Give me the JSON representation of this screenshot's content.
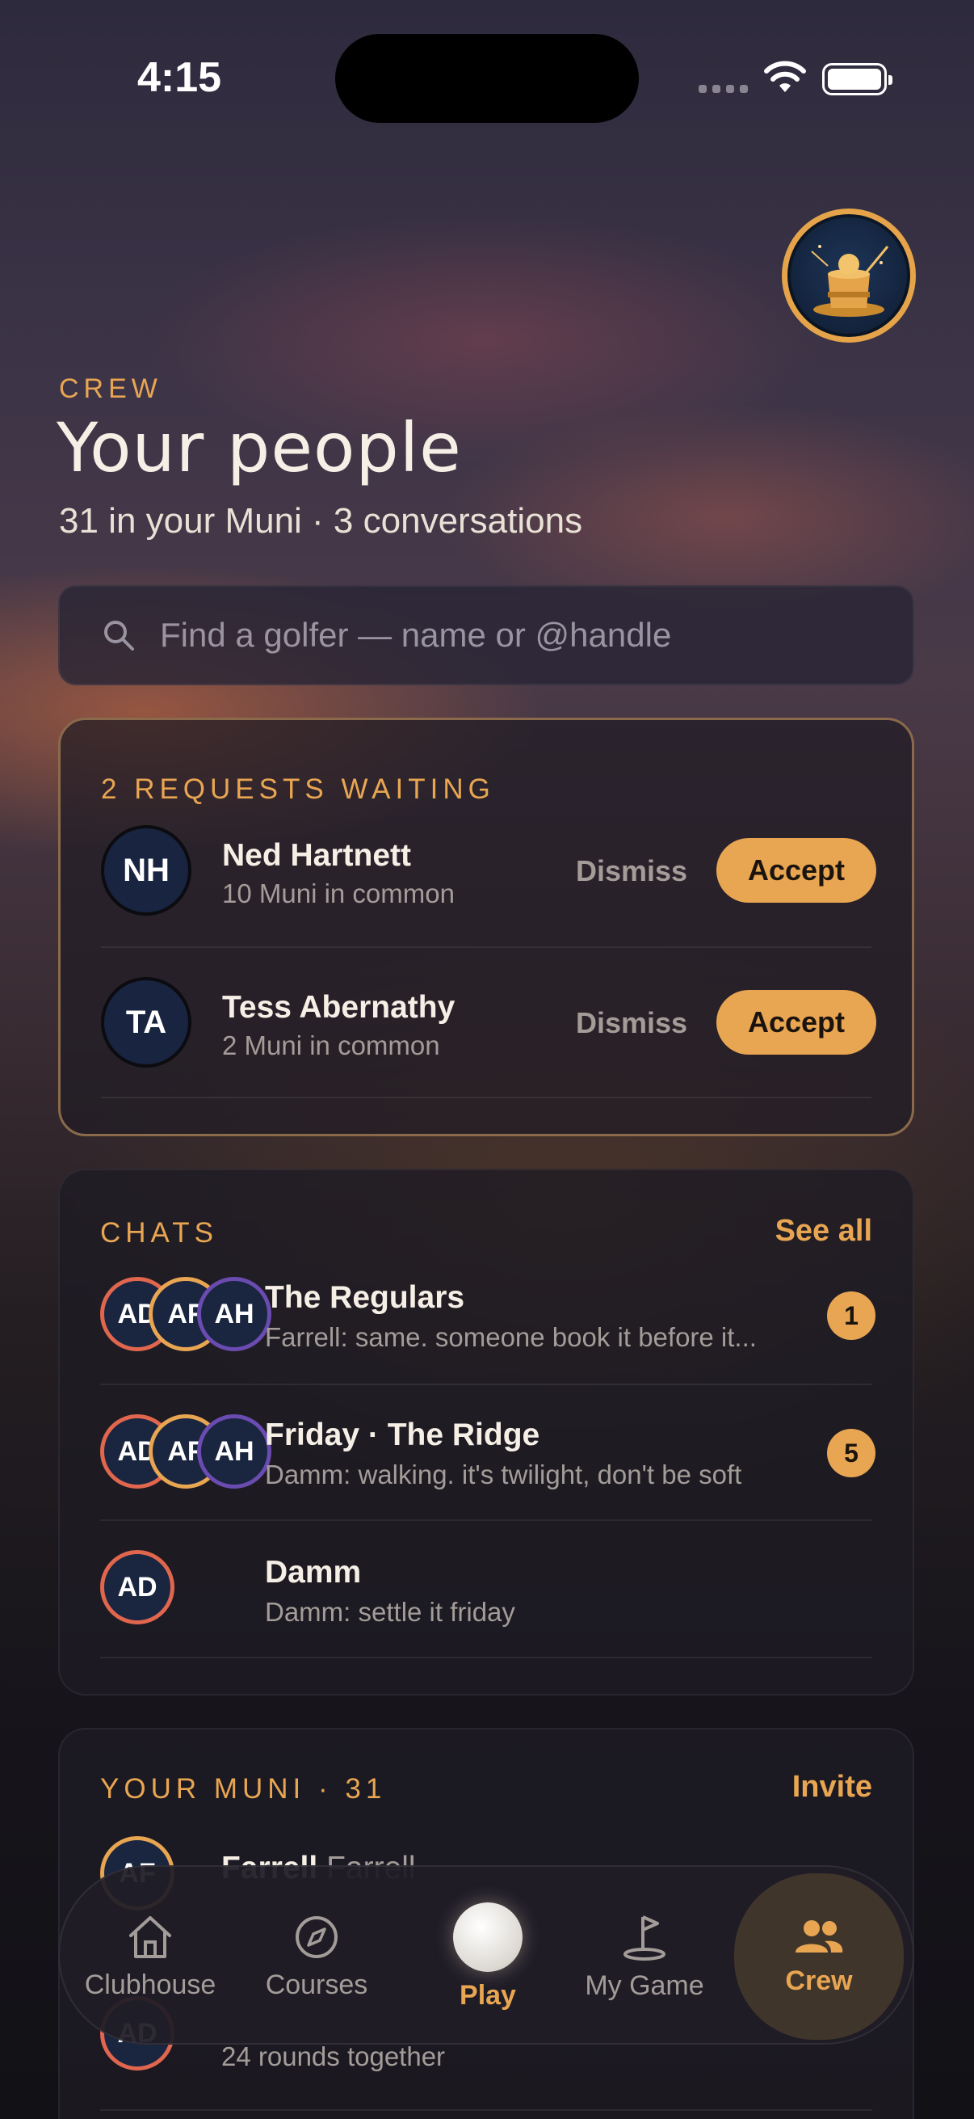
{
  "status_bar": {
    "time": "4:15"
  },
  "header": {
    "eyebrow": "CREW",
    "title": "Your people",
    "subtitle": "31 in your Muni · 3 conversations"
  },
  "search": {
    "placeholder": "Find a golfer — name or @handle",
    "value": ""
  },
  "requests": {
    "heading": "2 REQUESTS WAITING",
    "dismiss_label": "Dismiss",
    "accept_label": "Accept",
    "items": [
      {
        "initials": "NH",
        "name": "Ned Hartnett",
        "detail": "10 Muni in common"
      },
      {
        "initials": "TA",
        "name": "Tess Abernathy",
        "detail": "2 Muni in common"
      }
    ]
  },
  "chats": {
    "heading": "CHATS",
    "see_all": "See all",
    "items": [
      {
        "title": "The Regulars",
        "preview": "Farrell: same. someone book it before it...",
        "unread": "1",
        "avatars": [
          "AD",
          "AF",
          "AH"
        ]
      },
      {
        "title": "Friday · The Ridge",
        "preview": "Damm: walking. it's twilight, don't be soft",
        "unread": "5",
        "avatars": [
          "AD",
          "AF",
          "AH"
        ]
      },
      {
        "title": "Damm",
        "preview": "Damm: settle it friday",
        "unread": "",
        "avatars": [
          "AD"
        ]
      }
    ]
  },
  "muni": {
    "heading": "YOUR MUNI · 31",
    "invite": "Invite",
    "items": [
      {
        "initials": "AF",
        "name": "Farrell",
        "handle": "Farrell"
      },
      {
        "initials": "AD",
        "name": "",
        "detail": "24 rounds together"
      }
    ]
  },
  "tabbar": {
    "tabs": [
      {
        "label": "Clubhouse",
        "icon": "house-icon"
      },
      {
        "label": "Courses",
        "icon": "compass-icon"
      },
      {
        "label": "Play",
        "icon": "golf-ball-icon"
      },
      {
        "label": "My Game",
        "icon": "flag-pin-icon"
      },
      {
        "label": "Crew",
        "icon": "people-icon"
      }
    ],
    "active": "Crew"
  },
  "colors": {
    "accent": "#e8a552",
    "ring_red": "#e0664e",
    "ring_purple": "#6a4bb0",
    "avatar_navy": "#182440"
  }
}
